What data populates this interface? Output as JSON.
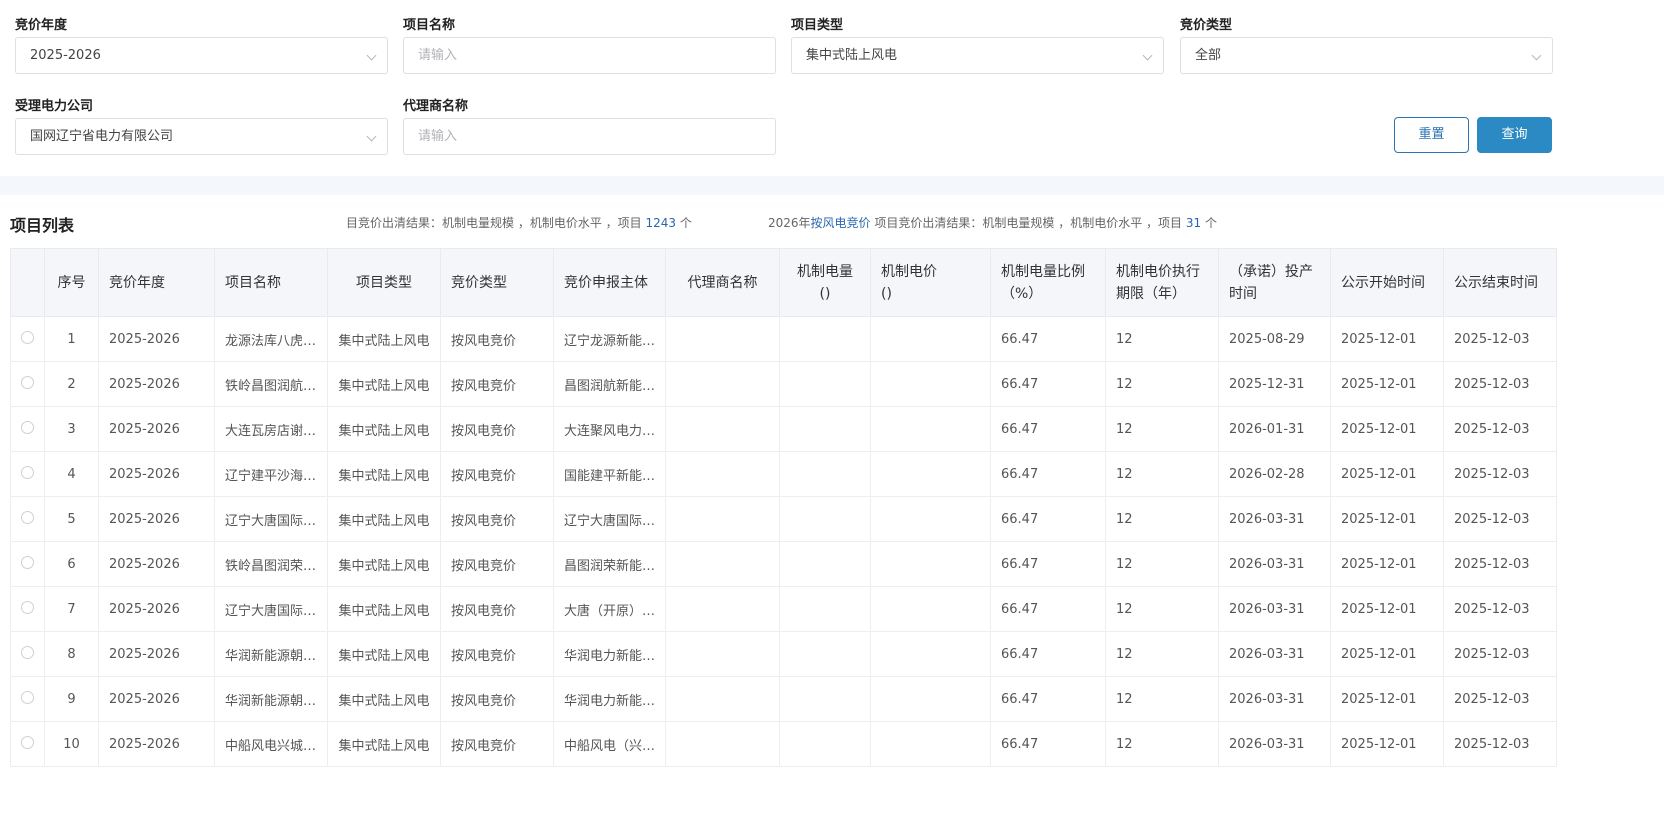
{
  "filters": {
    "year": {
      "label": "竞价年度",
      "value": "2025-2026"
    },
    "project_name": {
      "label": "项目名称",
      "placeholder": "请输入"
    },
    "project_type": {
      "label": "项目类型",
      "value": "集中式陆上风电"
    },
    "bid_type": {
      "label": "竞价类型",
      "value": "全部"
    },
    "power_company": {
      "label": "受理电力公司",
      "value": "国网辽宁省电力有限公司"
    },
    "agent_name": {
      "label": "代理商名称",
      "placeholder": "请输入"
    },
    "reset_label": "重置",
    "query_label": "查询"
  },
  "list": {
    "title": "项目列表",
    "summary1": {
      "prefix": "目竞价出清结果：机制电量规模 ，机制电价水平 ，项目",
      "count": "1243",
      "suffix": "个"
    },
    "summary2": {
      "year": "2026年",
      "type": "按风电竞价",
      "mid": "项目竞价出清结果：机制电量规模 ，机制电价水平 ，项目",
      "count": "31",
      "suffix": "个"
    }
  },
  "table": {
    "headers": [
      "序号",
      "竞价年度",
      "项目名称",
      "项目类型",
      "竞价类型",
      "竞价申报主体",
      "代理商名称",
      "机制电量\n()",
      "机制电价\n()",
      "机制电量比例\n（%）",
      "机制电价执行期限（年）",
      "（承诺）投产时间",
      "公示开始时间",
      "公示结束时间"
    ],
    "rows": [
      [
        "1",
        "2025-2026",
        "龙源法库八虎…",
        "集中式陆上风电",
        "按风电竞价",
        "辽宁龙源新能…",
        "",
        "",
        "",
        "66.47",
        "12",
        "2025-08-29",
        "2025-12-01",
        "2025-12-03"
      ],
      [
        "2",
        "2025-2026",
        "铁岭昌图润航…",
        "集中式陆上风电",
        "按风电竞价",
        "昌图润航新能…",
        "",
        "",
        "",
        "66.47",
        "12",
        "2025-12-31",
        "2025-12-01",
        "2025-12-03"
      ],
      [
        "3",
        "2025-2026",
        "大连瓦房店谢…",
        "集中式陆上风电",
        "按风电竞价",
        "大连聚风电力…",
        "",
        "",
        "",
        "66.47",
        "12",
        "2026-01-31",
        "2025-12-01",
        "2025-12-03"
      ],
      [
        "4",
        "2025-2026",
        "辽宁建平沙海…",
        "集中式陆上风电",
        "按风电竞价",
        "国能建平新能…",
        "",
        "",
        "",
        "66.47",
        "12",
        "2026-02-28",
        "2025-12-01",
        "2025-12-03"
      ],
      [
        "5",
        "2025-2026",
        "辽宁大唐国际…",
        "集中式陆上风电",
        "按风电竞价",
        "辽宁大唐国际…",
        "",
        "",
        "",
        "66.47",
        "12",
        "2026-03-31",
        "2025-12-01",
        "2025-12-03"
      ],
      [
        "6",
        "2025-2026",
        "铁岭昌图润荣…",
        "集中式陆上风电",
        "按风电竞价",
        "昌图润荣新能…",
        "",
        "",
        "",
        "66.47",
        "12",
        "2026-03-31",
        "2025-12-01",
        "2025-12-03"
      ],
      [
        "7",
        "2025-2026",
        "辽宁大唐国际…",
        "集中式陆上风电",
        "按风电竞价",
        "大唐（开原）…",
        "",
        "",
        "",
        "66.47",
        "12",
        "2026-03-31",
        "2025-12-01",
        "2025-12-03"
      ],
      [
        "8",
        "2025-2026",
        "华润新能源朝…",
        "集中式陆上风电",
        "按风电竞价",
        "华润电力新能…",
        "",
        "",
        "",
        "66.47",
        "12",
        "2026-03-31",
        "2025-12-01",
        "2025-12-03"
      ],
      [
        "9",
        "2025-2026",
        "华润新能源朝…",
        "集中式陆上风电",
        "按风电竞价",
        "华润电力新能…",
        "",
        "",
        "",
        "66.47",
        "12",
        "2026-03-31",
        "2025-12-01",
        "2025-12-03"
      ],
      [
        "10",
        "2025-2026",
        "中船风电兴城…",
        "集中式陆上风电",
        "按风电竞价",
        "中船风电（兴…",
        "",
        "",
        "",
        "66.47",
        "12",
        "2026-03-31",
        "2025-12-01",
        "2025-12-03"
      ]
    ]
  }
}
